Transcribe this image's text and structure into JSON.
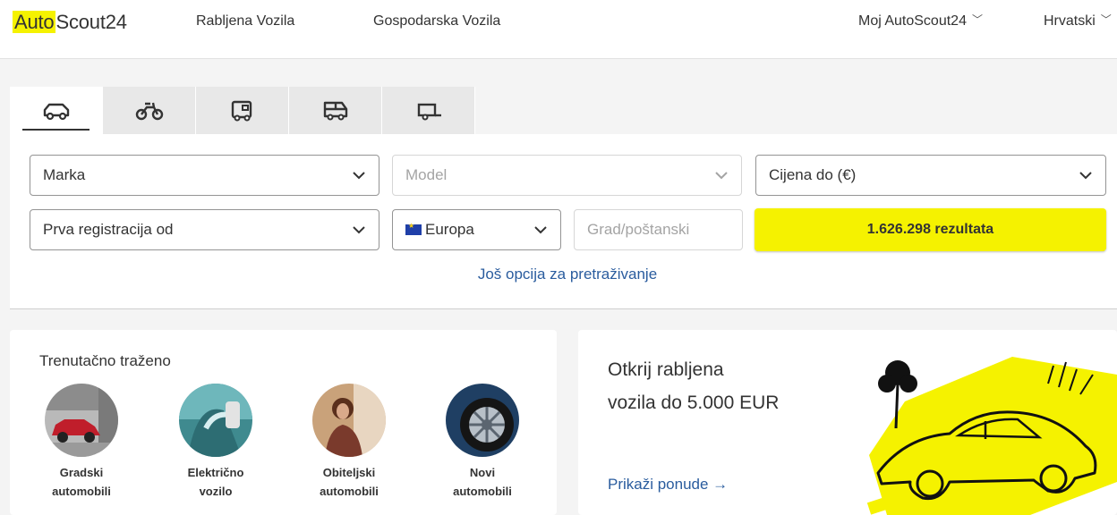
{
  "header": {
    "logo_part1": "Auto",
    "logo_part2": "Scout24",
    "nav": [
      "Rabljena Vozila",
      "Gospodarska Vozila"
    ],
    "account": "Moj AutoScout24",
    "language": "Hrvatski"
  },
  "tabs": [
    {
      "icon": "car-icon",
      "active": true
    },
    {
      "icon": "motorbike-icon",
      "active": false
    },
    {
      "icon": "camper-icon",
      "active": false
    },
    {
      "icon": "van-icon",
      "active": false
    },
    {
      "icon": "trailer-icon",
      "active": false
    }
  ],
  "search": {
    "make": "Marka",
    "model": "Model",
    "price": "Cijena do (€)",
    "first_registration": "Prva registracija od",
    "country": "Europa",
    "zip_placeholder": "Grad/poštanski",
    "results_button": "1.626.298 rezultata",
    "more_options": "Još opcija za pretraživanje"
  },
  "recent": {
    "title": "Trenutačno traženo",
    "items": [
      {
        "line1": "Gradski",
        "line2": "automobili"
      },
      {
        "line1": "Električno",
        "line2": "vozilo"
      },
      {
        "line1": "Obiteljski",
        "line2": "automobili"
      },
      {
        "line1": "Novi",
        "line2": "automobili"
      }
    ]
  },
  "promo": {
    "line1": "Otkrij rabljena",
    "line2": "vozila do 5.000 EUR",
    "link": "Prikaži ponude →"
  },
  "colors": {
    "brand_yellow": "#f5f200",
    "link_blue": "#2a5c9e",
    "text": "#333333",
    "background": "#f4f4f4"
  }
}
